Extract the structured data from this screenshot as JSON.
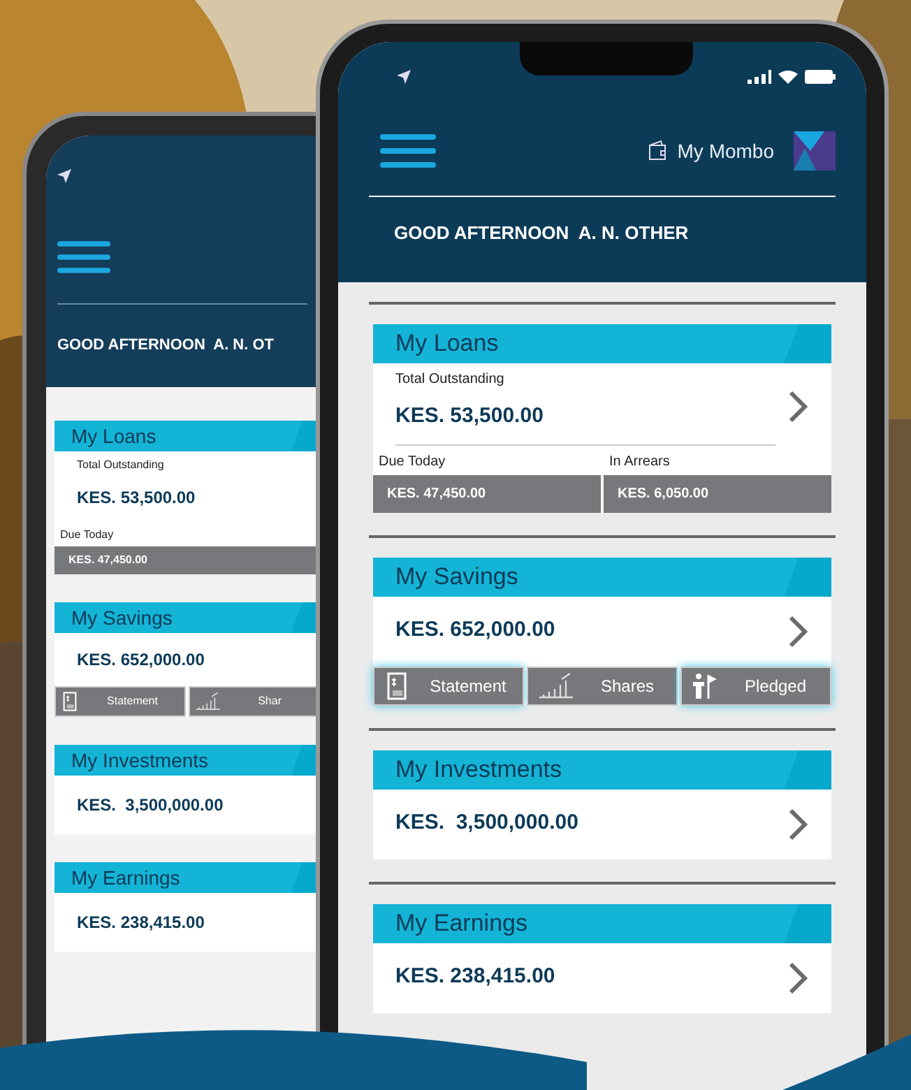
{
  "back_phone": {
    "greeting": "GOOD AFTERNOON  A. N. OT",
    "sections": [
      {
        "kind": "loans",
        "title": "My Loans",
        "label": "Total Outstanding",
        "amount": "KES. 53,500.00",
        "breakdown": [
          {
            "label": "Due Today",
            "value": "KES. 47,450.00"
          }
        ]
      },
      {
        "kind": "savings",
        "title": "My Savings",
        "amount": "KES. 652,000.00",
        "actions": [
          {
            "label": "Statement",
            "kind": "statement"
          },
          {
            "label": "Shar",
            "kind": "shares"
          }
        ]
      },
      {
        "kind": "simple",
        "title": "My Investments",
        "amount": "KES.  3,500,000.00"
      },
      {
        "kind": "simple",
        "title": "My Earnings",
        "amount": "KES. 238,415.00"
      }
    ]
  },
  "front_phone": {
    "app_name": "My Mombo",
    "greeting": "GOOD AFTERNOON  A. N. OTHER",
    "sections": [
      {
        "kind": "loans",
        "title": "My Loans",
        "label": "Total Outstanding",
        "amount": "KES. 53,500.00",
        "breakdown": [
          {
            "label": "Due Today",
            "value": "KES. 47,450.00"
          },
          {
            "label": "In Arrears",
            "value": "KES. 6,050.00"
          }
        ]
      },
      {
        "kind": "savings",
        "title": "My Savings",
        "amount": "KES. 652,000.00",
        "actions": [
          {
            "label": "Statement",
            "kind": "statement",
            "highlighted": true
          },
          {
            "label": "Shares",
            "kind": "shares",
            "highlighted": false
          },
          {
            "label": "Pledged",
            "kind": "pledged",
            "highlighted": true
          }
        ]
      },
      {
        "kind": "simple",
        "title": "My Investments",
        "amount": "KES.  3,500,000.00"
      },
      {
        "kind": "simple",
        "title": "My Earnings",
        "amount": "KES. 238,415.00"
      }
    ]
  }
}
